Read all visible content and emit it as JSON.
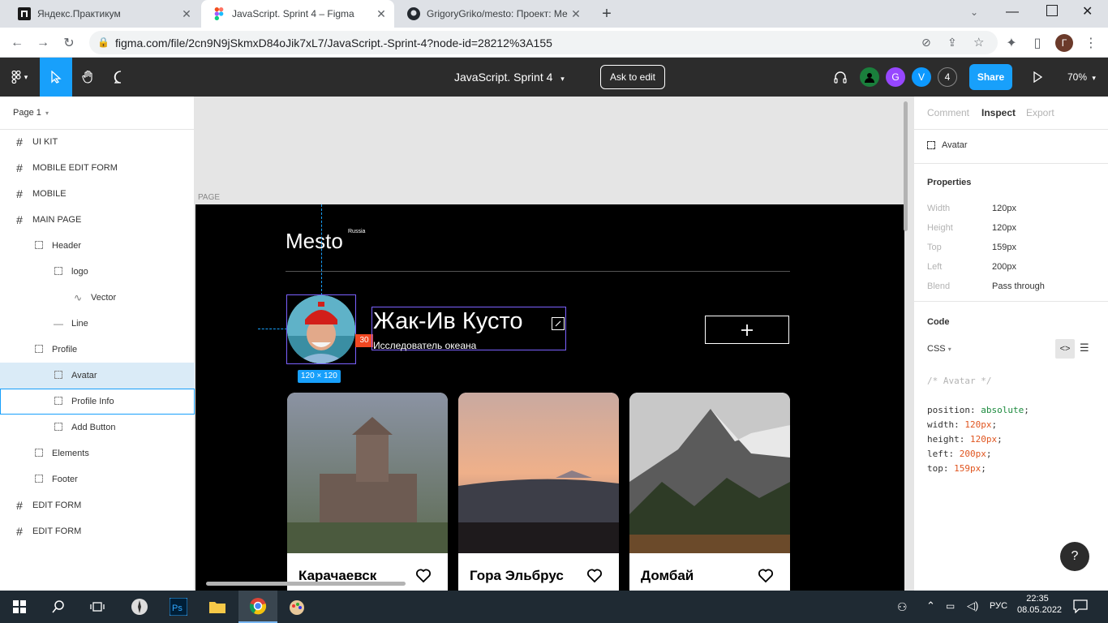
{
  "browser": {
    "tabs": [
      {
        "title": "Яндекс.Практикум",
        "favicon": "practicum-icon"
      },
      {
        "title": "JavaScript. Sprint 4 – Figma",
        "favicon": "figma-icon"
      },
      {
        "title": "GrigoryGriko/mesto: Проект: Ме",
        "favicon": "github-icon"
      }
    ],
    "url": "figma.com/file/2cn9N9jSkmxD84oJik7xL7/JavaScript.-Sprint-4?node-id=28212%3A155",
    "profile_initial": "Г"
  },
  "figma": {
    "file_title": "JavaScript. Sprint 4",
    "ask_to_edit": "Ask to edit",
    "share": "Share",
    "zoom": "70%",
    "collaborators": [
      {
        "initial": "",
        "color": "#1a7f3c"
      },
      {
        "initial": "G",
        "color": "#9747ff"
      },
      {
        "initial": "V",
        "color": "#0d99ff"
      },
      {
        "initial": "4",
        "color": "#444444"
      }
    ],
    "page_selector": "Page 1",
    "layers": [
      {
        "label": "UI KIT",
        "type": "frame",
        "indent": 0
      },
      {
        "label": "MOBILE EDIT FORM",
        "type": "frame",
        "indent": 0
      },
      {
        "label": "MOBILE",
        "type": "frame",
        "indent": 0
      },
      {
        "label": "MAIN PAGE",
        "type": "frame",
        "indent": 0
      },
      {
        "label": "Header",
        "type": "group",
        "indent": 1
      },
      {
        "label": "logo",
        "type": "group",
        "indent": 2
      },
      {
        "label": "Vector",
        "type": "vector",
        "indent": 3
      },
      {
        "label": "Line",
        "type": "line",
        "indent": 2
      },
      {
        "label": "Profile",
        "type": "group",
        "indent": 1
      },
      {
        "label": "Avatar",
        "type": "group",
        "indent": 2,
        "selected": true
      },
      {
        "label": "Profile Info",
        "type": "group",
        "indent": 2,
        "hover": true
      },
      {
        "label": "Add Button",
        "type": "group",
        "indent": 2
      },
      {
        "label": "Elements",
        "type": "group",
        "indent": 1
      },
      {
        "label": "Footer",
        "type": "group",
        "indent": 1
      },
      {
        "label": "EDIT FORM",
        "type": "frame",
        "indent": 0
      },
      {
        "label": "EDIT FORM",
        "type": "frame",
        "indent": 0
      }
    ],
    "canvas": {
      "page_label": "PAGE",
      "logo": "Mesto",
      "logo_sup": "Russia",
      "profile_name": "Жак-Ив Кусто",
      "profile_about": "Исследователь океана",
      "avatar_size": "120 × 120",
      "distance_badge": "30",
      "cards": [
        {
          "caption": "Карачаевск"
        },
        {
          "caption": "Гора Эльбрус"
        },
        {
          "caption": "Домбай"
        }
      ]
    },
    "inspect": {
      "tabs": [
        "Comment",
        "Inspect",
        "Export"
      ],
      "active_tab": "Inspect",
      "layer_name": "Avatar",
      "properties_title": "Properties",
      "properties": [
        {
          "k": "Width",
          "v": "120px"
        },
        {
          "k": "Height",
          "v": "120px"
        },
        {
          "k": "Top",
          "v": "159px"
        },
        {
          "k": "Left",
          "v": "200px"
        },
        {
          "k": "Blend",
          "v": "Pass through"
        }
      ],
      "code_title": "Code",
      "code_lang": "CSS",
      "code_comment": "/* Avatar */",
      "code_lines": [
        {
          "prop": "position",
          "val": "absolute",
          "kind": "kw"
        },
        {
          "prop": "width",
          "val": "120px",
          "kind": "num"
        },
        {
          "prop": "height",
          "val": "120px",
          "kind": "num"
        },
        {
          "prop": "left",
          "val": "200px",
          "kind": "num"
        },
        {
          "prop": "top",
          "val": "159px",
          "kind": "num"
        }
      ],
      "help": "?"
    }
  },
  "taskbar": {
    "lang": "РУС",
    "time": "22:35",
    "date": "08.05.2022"
  }
}
